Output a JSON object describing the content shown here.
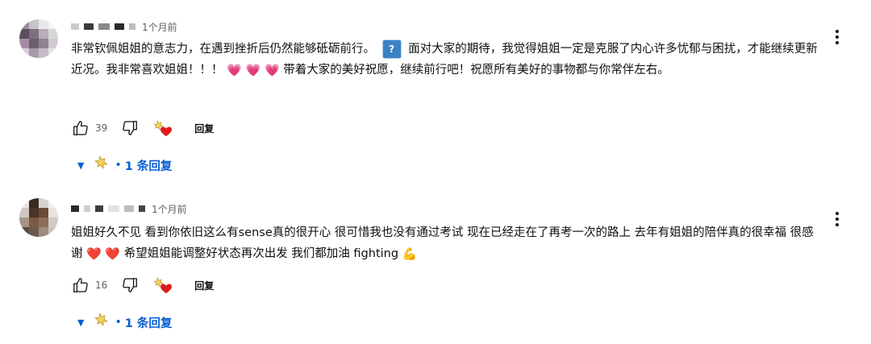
{
  "comments": [
    {
      "time": "1个月前",
      "text_part1": "非常钦佩姐姐的意志力，在遇到挫折后仍然能够砥砺前行。",
      "unknown_glyph": "?",
      "text_part2": "面对大家的期待，我觉得姐姐一定是克服了内心许多忧郁与困扰，才能继续更新近况。我非常喜欢姐姐！！！",
      "emoji_group1": "💗 💗 💗",
      "text_part3": "带着大家的美好祝愿，继续前行吧！祝愿所有美好的事物都与你常伴左右。",
      "likes": "39",
      "reply_label": "回复",
      "replies_label": "1 条回复"
    },
    {
      "time": "1个月前",
      "text_part1": "姐姐好久不见 看到你依旧这么有sense真的很开心 很可惜我也没有通过考试 现在已经走在了再考一次的路上 去年有姐姐的陪伴真的很幸福 很感谢",
      "emoji_group1": "❤️",
      "emoji_group2": "❤️",
      "text_part2": "希望姐姐能调整好状态再次出发 我们都加油 fighting",
      "emoji_group3": "💪",
      "likes": "16",
      "reply_label": "回复",
      "replies_label": "1 条回复"
    }
  ],
  "icons": {
    "like": "thumbs-up-icon",
    "dislike": "thumbs-down-icon",
    "creator_heart": "creator-heart-icon",
    "more": "more-vert-icon",
    "expand": "caret-down-icon"
  },
  "colors": {
    "link_blue": "#065fd4",
    "text": "#0f0f0f",
    "muted": "#606060",
    "heart_red": "#e01b1b"
  }
}
